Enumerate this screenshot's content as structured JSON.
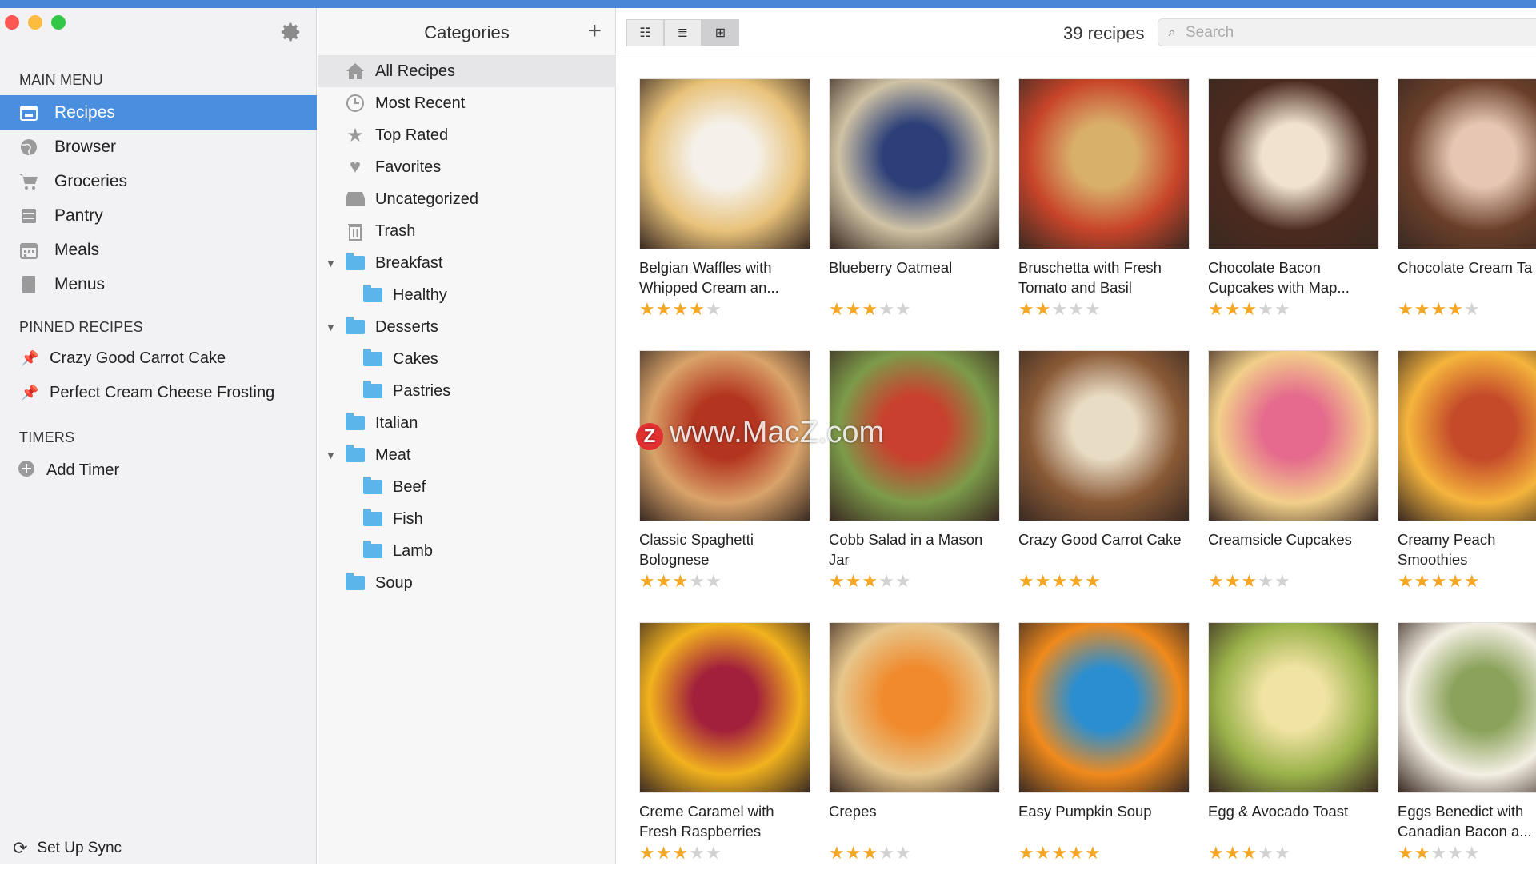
{
  "sidebar": {
    "main_menu_title": "MAIN MENU",
    "menu": [
      {
        "label": "Recipes",
        "icon": "recipes-icon",
        "active": true
      },
      {
        "label": "Browser",
        "icon": "globe-icon"
      },
      {
        "label": "Groceries",
        "icon": "cart-icon"
      },
      {
        "label": "Pantry",
        "icon": "pantry-icon"
      },
      {
        "label": "Meals",
        "icon": "calendar-icon"
      },
      {
        "label": "Menus",
        "icon": "menu-book-icon"
      }
    ],
    "pinned_title": "PINNED RECIPES",
    "pinned": [
      {
        "label": "Crazy Good Carrot Cake"
      },
      {
        "label": "Perfect Cream Cheese Frosting"
      }
    ],
    "timers_title": "TIMERS",
    "add_timer": "Add Timer",
    "sync": "Set Up Sync"
  },
  "categories": {
    "title": "Categories",
    "add": "+",
    "items": [
      {
        "label": "All Recipes",
        "icon": "home-icon"
      },
      {
        "label": "Most Recent",
        "icon": "clock-icon"
      },
      {
        "label": "Top Rated",
        "icon": "star-icon"
      },
      {
        "label": "Favorites",
        "icon": "heart-icon"
      },
      {
        "label": "Uncategorized",
        "icon": "tray-icon"
      },
      {
        "label": "Trash",
        "icon": "trash-icon"
      },
      {
        "label": "Breakfast",
        "icon": "folder-icon",
        "expanded": true
      },
      {
        "label": "Healthy",
        "icon": "folder-icon"
      },
      {
        "label": "Desserts",
        "icon": "folder-icon",
        "expanded": true
      },
      {
        "label": "Cakes",
        "icon": "folder-icon"
      },
      {
        "label": "Pastries",
        "icon": "folder-icon"
      },
      {
        "label": "Italian",
        "icon": "folder-icon"
      },
      {
        "label": "Meat",
        "icon": "folder-icon",
        "expanded": true
      },
      {
        "label": "Beef",
        "icon": "folder-icon"
      },
      {
        "label": "Fish",
        "icon": "folder-icon"
      },
      {
        "label": "Lamb",
        "icon": "folder-icon"
      },
      {
        "label": "Soup",
        "icon": "folder-icon"
      }
    ]
  },
  "toolbar": {
    "count": "39 recipes",
    "search_placeholder": "Search",
    "watermark": "www.MacZ.com",
    "watermark_logo": "Z"
  },
  "recipes": [
    {
      "title": "Belgian Waffles with Whipped Cream an...",
      "rating": 4,
      "colors": [
        "#e8c27a",
        "#f5f1ea"
      ]
    },
    {
      "title": "Blueberry Oatmeal",
      "rating": 3,
      "colors": [
        "#cfc2a4",
        "#2c3f78"
      ]
    },
    {
      "title": "Bruschetta with Fresh Tomato and Basil",
      "rating": 2,
      "colors": [
        "#c7442a",
        "#d9b06a"
      ]
    },
    {
      "title": "Chocolate Bacon Cupcakes with Map...",
      "rating": 3,
      "colors": [
        "#4b2a1e",
        "#f0e2cf"
      ]
    },
    {
      "title": "Chocolate Cream Ta",
      "rating": 4,
      "colors": [
        "#6a3f2a",
        "#e7c7b4"
      ]
    },
    {
      "title": "Classic Spaghetti Bolognese",
      "rating": 3,
      "colors": [
        "#d9a36a",
        "#b3341f"
      ]
    },
    {
      "title": "Cobb Salad in a Mason Jar",
      "rating": 3,
      "colors": [
        "#7c9b4a",
        "#c9402e"
      ]
    },
    {
      "title": "Crazy Good Carrot Cake",
      "rating": 5,
      "colors": [
        "#8a5a36",
        "#e9dcc5"
      ]
    },
    {
      "title": "Creamsicle Cupcakes",
      "rating": 3,
      "colors": [
        "#f2cf8a",
        "#e56a8d"
      ]
    },
    {
      "title": "Creamy Peach Smoothies",
      "rating": 5,
      "colors": [
        "#f5b43c",
        "#c44a2a"
      ]
    },
    {
      "title": "Creme Caramel with Fresh Raspberries",
      "rating": 3,
      "colors": [
        "#f2b21e",
        "#a2203b"
      ]
    },
    {
      "title": "Crepes",
      "rating": 3,
      "colors": [
        "#e7c68c",
        "#f08a2c"
      ]
    },
    {
      "title": "Easy Pumpkin Soup",
      "rating": 5,
      "colors": [
        "#f08a1c",
        "#2b8ed0"
      ]
    },
    {
      "title": "Egg & Avocado Toast",
      "rating": 3,
      "colors": [
        "#9ab24a",
        "#f1e3a3"
      ]
    },
    {
      "title": "Eggs Benedict with Canadian Bacon a...",
      "rating": 2,
      "colors": [
        "#f4efe4",
        "#8aa25a"
      ]
    }
  ]
}
